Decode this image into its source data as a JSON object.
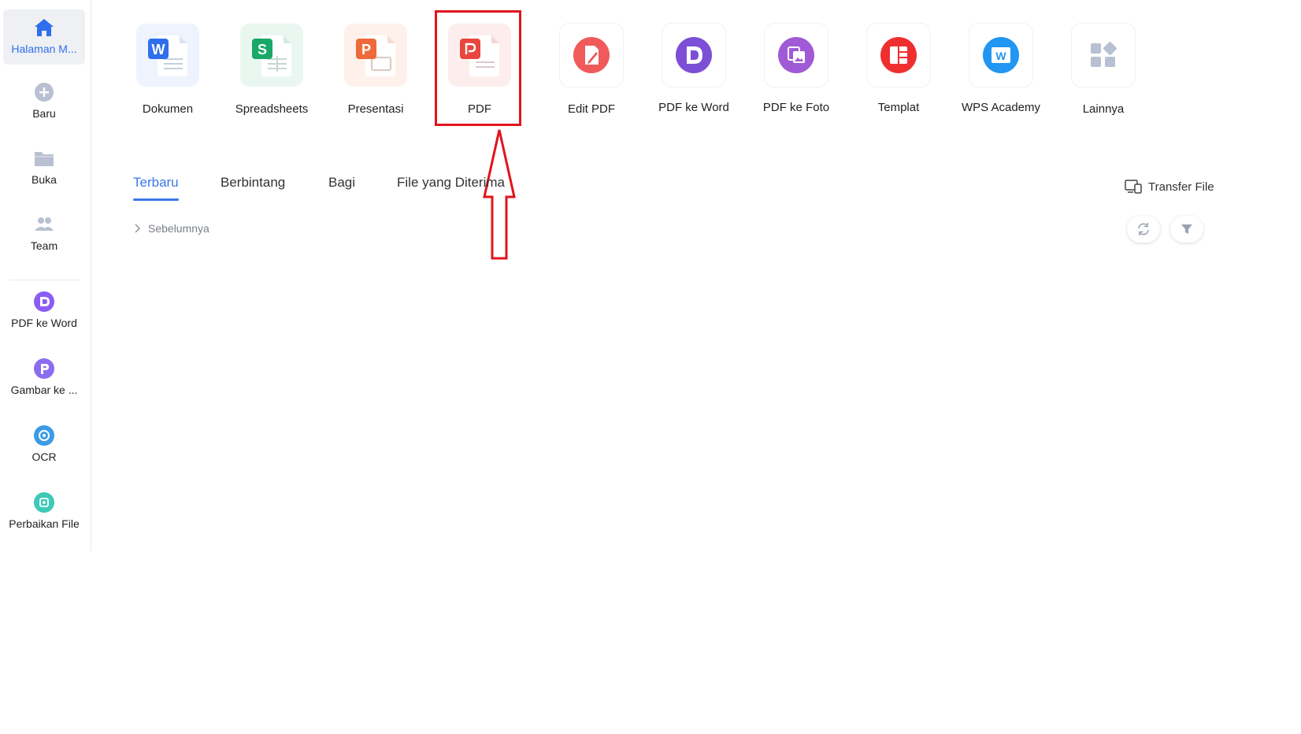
{
  "sidebar": {
    "items": [
      {
        "label": "Halaman M...",
        "icon": "home-icon",
        "color": "#2f6fed"
      },
      {
        "label": "Baru",
        "icon": "plus-circle-icon",
        "color": "#b8c1d1"
      },
      {
        "label": "Buka",
        "icon": "folder-icon",
        "color": "#b8c1d1"
      },
      {
        "label": "Team",
        "icon": "team-icon",
        "color": "#b8c1d1"
      },
      {
        "label": "PDF ke Word",
        "icon": "pdf-to-word-icon",
        "color": "#8b5cf6"
      },
      {
        "label": "Gambar ke ...",
        "icon": "image-to-text-icon",
        "color": "#8b6cf0"
      },
      {
        "label": "OCR",
        "icon": "ocr-icon",
        "color": "#3b9be6"
      },
      {
        "label": "Perbaikan File",
        "icon": "file-repair-icon",
        "color": "#3fc9b7"
      }
    ]
  },
  "apps": [
    {
      "label": "Dokumen",
      "icon": "writer-icon",
      "color": "#2f6fed",
      "letter": "W"
    },
    {
      "label": "Spreadsheets",
      "icon": "spreadsheet-icon",
      "color": "#1aa868",
      "letter": "S"
    },
    {
      "label": "Presentasi",
      "icon": "presentation-icon",
      "color": "#ee6a3a",
      "letter": "P"
    },
    {
      "label": "PDF",
      "icon": "pdf-icon",
      "color": "#e8473f",
      "letter": "P"
    },
    {
      "label": "Edit PDF",
      "icon": "edit-pdf-icon",
      "color": "#f05a5a"
    },
    {
      "label": "PDF ke Word",
      "icon": "pdf-to-word-icon",
      "color": "#7c4fd6"
    },
    {
      "label": "PDF ke Foto",
      "icon": "pdf-to-photo-icon",
      "color": "#a05ad6"
    },
    {
      "label": "Templat",
      "icon": "template-icon",
      "color": "#ef2f2f"
    },
    {
      "label": "WPS Academy",
      "icon": "wps-academy-icon",
      "color": "#2196f3"
    },
    {
      "label": "Lainnya",
      "icon": "more-apps-icon",
      "color": "#b8c1d1"
    }
  ],
  "tabs": [
    {
      "label": "Terbaru",
      "active": true
    },
    {
      "label": "Berbintang",
      "active": false
    },
    {
      "label": "Bagi",
      "active": false
    },
    {
      "label": "File yang Diterima",
      "active": false
    }
  ],
  "toolbar": {
    "transfer_label": "Transfer File",
    "transfer_icon": "transfer-file-icon",
    "refresh_icon": "refresh-icon",
    "filter_icon": "filter-icon"
  },
  "list": {
    "previous_label": "Sebelumnya",
    "previous_icon": "chevron-right-icon"
  },
  "annotation": {
    "highlight_color": "#e0141d"
  }
}
